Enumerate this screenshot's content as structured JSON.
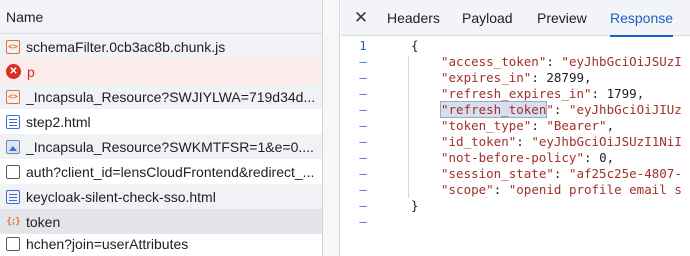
{
  "network_list": {
    "header": "Name",
    "rows": [
      {
        "label": "schemaFilter.0cb3ac8b.chunk.js",
        "icon": "js-file-icon"
      },
      {
        "label": "p",
        "icon": "error-icon"
      },
      {
        "label": "_Incapsula_Resource?SWJIYLWA=719d34d...",
        "icon": "js-file-icon"
      },
      {
        "label": "step2.html",
        "icon": "document-icon"
      },
      {
        "label": "_Incapsula_Resource?SWKMTFSR=1&e=0....",
        "icon": "image-icon"
      },
      {
        "label": "auth?client_id=lensCloudFrontend&redirect_...",
        "icon": "blank-file-icon"
      },
      {
        "label": "keycloak-silent-check-sso.html",
        "icon": "document-icon"
      },
      {
        "label": "token",
        "icon": "xhr-icon"
      },
      {
        "label": "hchen?join=userAttributes",
        "icon": "blank-file-icon"
      }
    ]
  },
  "detail": {
    "close": "✕",
    "tabs": [
      "Headers",
      "Payload",
      "Preview",
      "Response"
    ],
    "active_tab": "Response",
    "gutter": [
      "1",
      "–",
      "–",
      "–",
      "–",
      "–",
      "–",
      "–",
      "–",
      "–",
      "–",
      "–"
    ],
    "code": {
      "open": "{",
      "l1_key": "\"access_token\"",
      "l1_val": "\"eyJhbGciOiJSUzI",
      "l2_key": "\"expires_in\"",
      "l2_val": "28799",
      "l3_key": "\"refresh_expires_in\"",
      "l3_val": "1799",
      "l4_key_hl": "\"refresh_token",
      "l4_key_rest": "\"",
      "l4_val": "\"eyJhbGciOiJIUz",
      "l5_key": "\"token_type\"",
      "l5_val": "\"Bearer\"",
      "l6_key": "\"id_token\"",
      "l6_val": "\"eyJhbGciOiJSUzI1NiI",
      "l7_key": "\"not-before-policy\"",
      "l7_val": "0",
      "l8_key": "\"session_state\"",
      "l8_val": "\"af25c25e-4807-",
      "l9_key": "\"scope\"",
      "l9_val": "\"openid profile email s",
      "close": "}",
      "colon": ": ",
      "comma": ","
    }
  },
  "colors": {
    "accent": "#1a5fc7",
    "json_string": "#a1302a",
    "error": "#d93025"
  }
}
